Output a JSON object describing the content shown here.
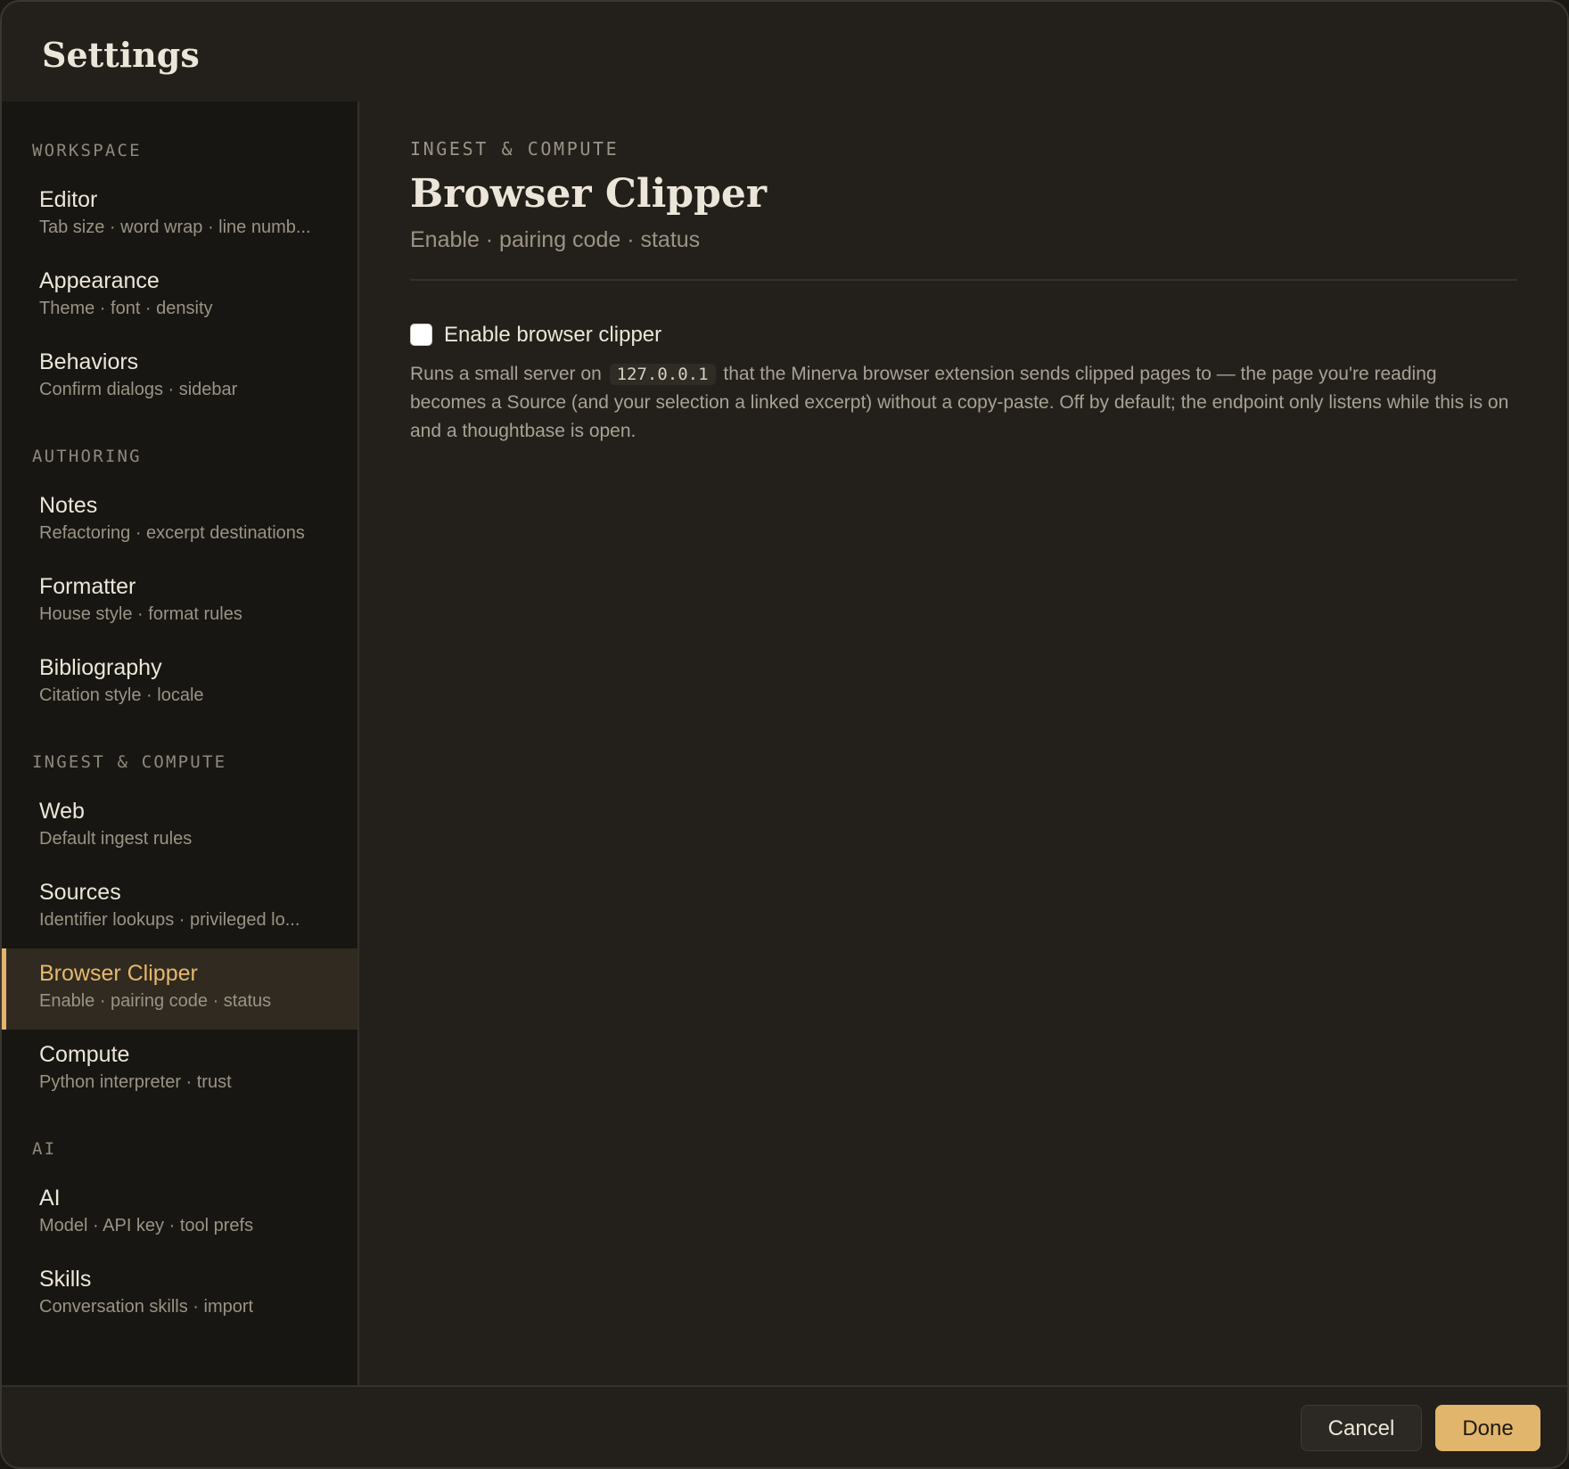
{
  "header": {
    "title": "Settings"
  },
  "sidebar": {
    "sections": [
      {
        "label": "WORKSPACE",
        "items": [
          {
            "title": "Editor",
            "subtitle": "Tab size · word wrap · line numb..."
          },
          {
            "title": "Appearance",
            "subtitle": "Theme · font · density"
          },
          {
            "title": "Behaviors",
            "subtitle": "Confirm dialogs · sidebar"
          }
        ]
      },
      {
        "label": "AUTHORING",
        "items": [
          {
            "title": "Notes",
            "subtitle": "Refactoring · excerpt destinations"
          },
          {
            "title": "Formatter",
            "subtitle": "House style · format rules"
          },
          {
            "title": "Bibliography",
            "subtitle": "Citation style · locale"
          }
        ]
      },
      {
        "label": "INGEST & COMPUTE",
        "items": [
          {
            "title": "Web",
            "subtitle": "Default ingest rules"
          },
          {
            "title": "Sources",
            "subtitle": "Identifier lookups · privileged lo..."
          },
          {
            "title": "Browser Clipper",
            "subtitle": "Enable · pairing code · status",
            "active": true
          },
          {
            "title": "Compute",
            "subtitle": "Python interpreter · trust"
          }
        ]
      },
      {
        "label": "AI",
        "items": [
          {
            "title": "AI",
            "subtitle": "Model · API key · tool prefs"
          },
          {
            "title": "Skills",
            "subtitle": "Conversation skills · import"
          }
        ]
      }
    ]
  },
  "content": {
    "eyebrow": "INGEST & COMPUTE",
    "title": "Browser Clipper",
    "subtitle": "Enable · pairing code · status",
    "option": {
      "label": "Enable browser clipper",
      "checked": false,
      "desc_before": "Runs a small server on",
      "desc_code": "127.0.0.1",
      "desc_after": "that the Minerva browser extension sends clipped pages to — the page you're reading becomes a Source (and your selection a linked excerpt) without a copy-paste. Off by default; the endpoint only listens while this is on and a thoughtbase is open."
    }
  },
  "footer": {
    "cancel_label": "Cancel",
    "done_label": "Done"
  },
  "colors": {
    "accent": "#e1b56b",
    "background": "#23201b",
    "sidebar_background": "#181612",
    "active_item_background": "#302a20"
  }
}
